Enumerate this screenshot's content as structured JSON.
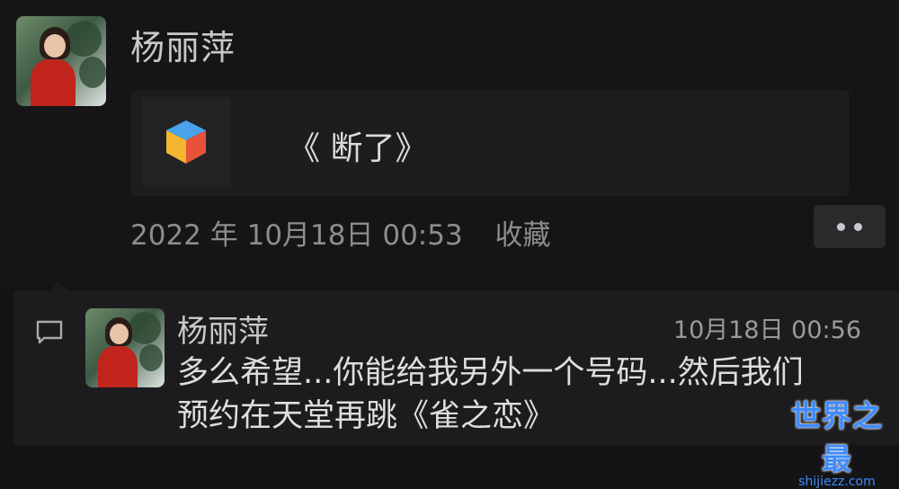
{
  "post": {
    "author_name": "杨丽萍",
    "music_card": {
      "title": "《 断了》",
      "icon": "colorful-cube-icon"
    },
    "date": "2022 年 10月18日 00:53",
    "favorite_label": "收藏",
    "more_icon": "two-dots-icon"
  },
  "comment": {
    "icon": "comment-icon",
    "author_name": "杨丽萍",
    "time": "10月18日 00:56",
    "text_line1": "多么希望...你能给我另外一个号码...然后我们",
    "text_line2": "预约在天堂再跳《雀之恋》"
  },
  "watermark": {
    "main": "世界之最",
    "url": "shijiezz.com"
  },
  "colors": {
    "background": "#141416",
    "card": "#1d1d20",
    "comment_panel": "#1c1c1e",
    "watermark_blue": "#3d8bff"
  }
}
